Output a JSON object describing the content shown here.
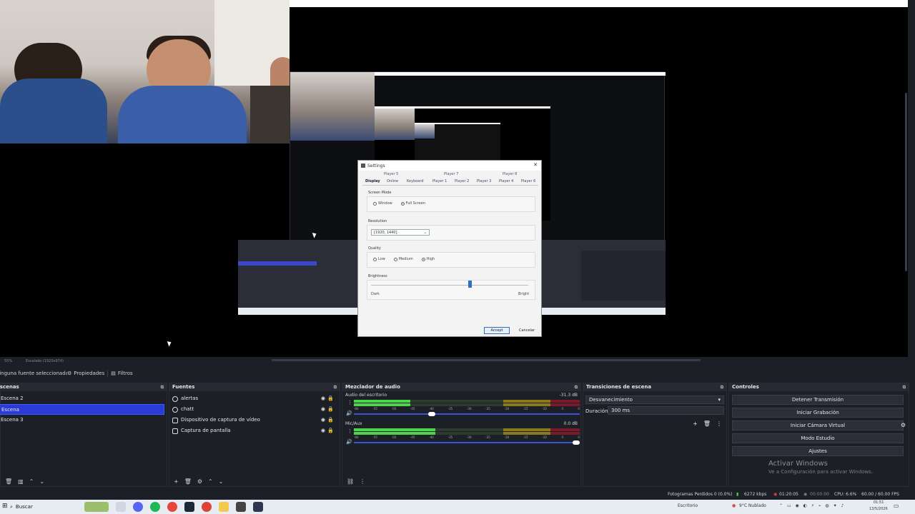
{
  "dialog": {
    "title": "Settings",
    "top_tabs": [
      "Player 5",
      "Player 7",
      "Player 8"
    ],
    "tabs": [
      "Display",
      "Online",
      "Keyboard",
      "Player 1",
      "Player 2",
      "Player 3",
      "Player 4",
      "Player 6"
    ],
    "screen_mode": {
      "label": "Screen Mode",
      "options": [
        "Window",
        "Full Screen"
      ],
      "selected": "Full Screen"
    },
    "resolution": {
      "label": "Resolution",
      "value": "[1920, 1440]"
    },
    "quality": {
      "label": "Quality",
      "options": [
        "Low",
        "Medium",
        "High"
      ],
      "selected": "High"
    },
    "brightness": {
      "label": "Brightness",
      "min_label": "Dark",
      "max_label": "Bright",
      "value_fraction": 0.62
    },
    "accept": "Accept",
    "cancel": "Cancelar"
  },
  "preview_status": {
    "zoom": "55%",
    "scale": "Escalado (1920x974)"
  },
  "source_toolbar": {
    "none": "Ninguna fuente seleccionada",
    "properties": "Propiedades",
    "filters": "Filtros"
  },
  "scenes": {
    "title": "Escenas",
    "items": [
      "Escena 2",
      "Escena",
      "Escena 3"
    ],
    "selected_index": 1
  },
  "sources": {
    "title": "Fuentes",
    "items": [
      "alertas",
      "chatt",
      "Dispositivo de captura de vídeo",
      "Captura de pantalla"
    ]
  },
  "mixer": {
    "title": "Mezclador de audio",
    "channels": [
      {
        "name": "Audio del escritorio",
        "db": "-31.3 dB",
        "level": 0.25,
        "volume": 0.36
      },
      {
        "name": "Mic/Aux",
        "db": "0.0 dB",
        "level": 0.36,
        "volume": 1.0
      }
    ],
    "ticks": [
      "-60",
      "-55",
      "-50",
      "-45",
      "-40",
      "-35",
      "-30",
      "-25",
      "-20",
      "-15",
      "-10",
      "-5",
      "0"
    ]
  },
  "transitions": {
    "title": "Transiciones de escena",
    "type": "Desvanecimiento",
    "duration_label": "Duración",
    "duration": "300 ms"
  },
  "controls": {
    "title": "Controles",
    "buttons": [
      "Detener Transmisión",
      "Iniciar Grabación",
      "Iniciar Cámara Virtual",
      "Modo Estudio",
      "Ajustes"
    ]
  },
  "activate_windows": {
    "title": "Activar Windows",
    "subtitle": "Ve a Configuración para activar Windows."
  },
  "status": {
    "frames_lost": "Fotogramas Perdidos 0 (0.0%)",
    "kbps": "6272 kbps",
    "live_time": "01:20:05",
    "rec_time": "00:00:00",
    "cpu": "CPU: 6.6%",
    "fps": "60.00 / 60.00 FPS"
  },
  "taskbar": {
    "search": "Buscar",
    "weather": "9°C  Nublado",
    "lang": "Escritorio",
    "time": "01:51",
    "date": "13/5/2026"
  },
  "colors": {
    "accent": "#2a3bd6",
    "meter_green": "#4bd54b",
    "meter_yellow": "#8a7a1a",
    "meter_red": "#7a1a2a",
    "background": "#1d1f26"
  }
}
